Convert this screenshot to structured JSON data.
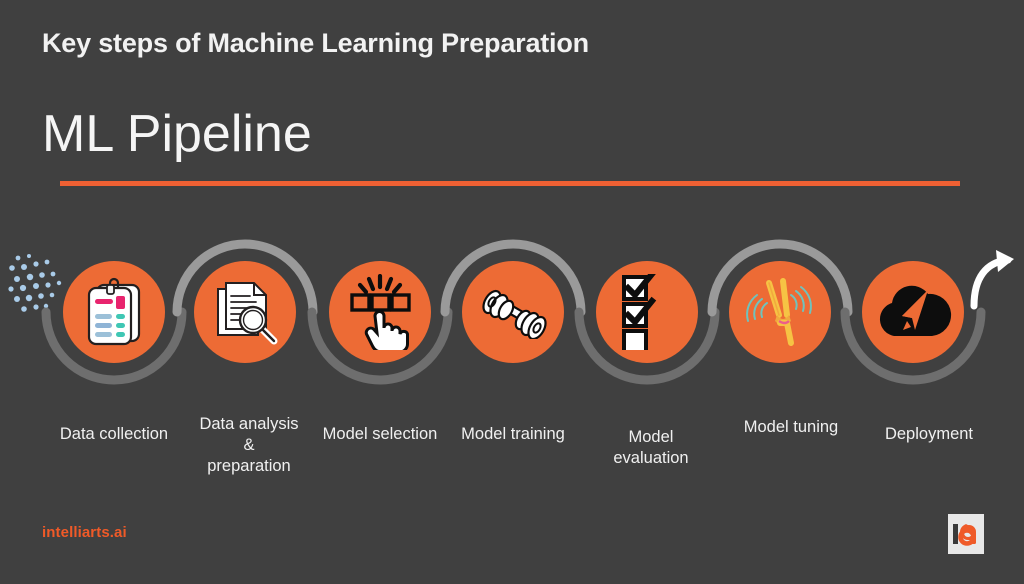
{
  "slide": {
    "kicker": "Key steps of Machine Learning Preparation",
    "headline": "ML Pipeline",
    "background_color": "#404040",
    "accent_color": "#ed6b35",
    "rule_color": "#ef6033"
  },
  "pipeline": {
    "steps": [
      {
        "label": "Data collection",
        "icon": "clipboard-icon",
        "arc": "bottom"
      },
      {
        "label": "Data analysis\n&\npreparation",
        "icon": "document-search-icon",
        "arc": "top"
      },
      {
        "label": "Model selection",
        "icon": "select-option-hand-icon",
        "arc": "bottom"
      },
      {
        "label": "Model training",
        "icon": "dumbbell-icon",
        "arc": "top"
      },
      {
        "label": "Model\nevaluation",
        "icon": "checklist-icon",
        "arc": "bottom"
      },
      {
        "label": "Model tuning",
        "icon": "tuning-fork-icon",
        "arc": "top"
      },
      {
        "label": "Deployment",
        "icon": "cloud-upload-icon",
        "arc": "bottom"
      }
    ],
    "decorations": {
      "scatter_dots": "data-particles-icon",
      "end_arrow": "curved-arrow-icon"
    },
    "arc_color_top": "#9a9a9a",
    "arc_color_bottom": "#6e6e6e",
    "circle_color": "#ed6b35"
  },
  "footer": {
    "brand": "intelliarts.ai",
    "brand_color": "#f05a28",
    "logo": "intelliarts-logo"
  }
}
